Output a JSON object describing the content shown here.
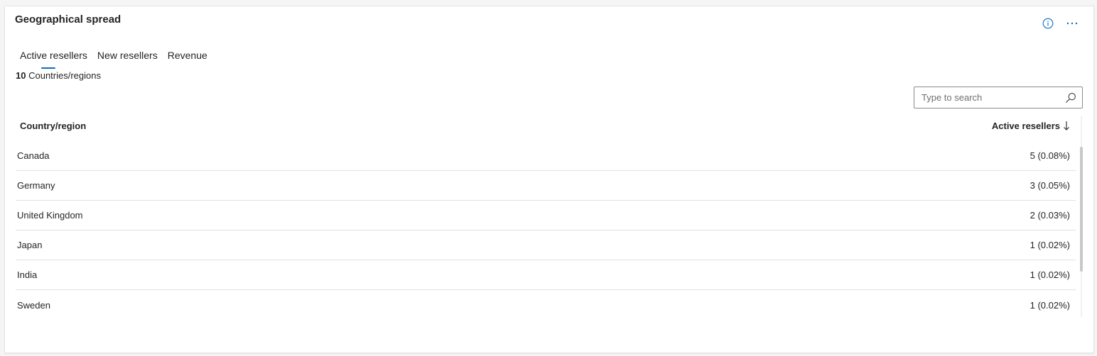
{
  "widget": {
    "title": "Geographical spread",
    "info_icon": "info-icon",
    "more_icon": "more-horizontal-icon"
  },
  "tabs": [
    {
      "label": "Active resellers",
      "active": true
    },
    {
      "label": "New resellers",
      "active": false
    },
    {
      "label": "Revenue",
      "active": false
    }
  ],
  "summary": {
    "count": "10",
    "label": "Countries/regions"
  },
  "search": {
    "placeholder": "Type to search",
    "value": "",
    "icon": "search-icon"
  },
  "table": {
    "headers": {
      "country": "Country/region",
      "value": "Active resellers",
      "sort_icon": "arrow-down-icon"
    },
    "rows": [
      {
        "country": "Canada",
        "value": "5 (0.08%)"
      },
      {
        "country": "Germany",
        "value": "3 (0.05%)"
      },
      {
        "country": "United Kingdom",
        "value": "2 (0.03%)"
      },
      {
        "country": "Japan",
        "value": "1 (0.02%)"
      },
      {
        "country": "India",
        "value": "1 (0.02%)"
      },
      {
        "country": "Sweden",
        "value": "1 (0.02%)"
      }
    ]
  },
  "colors": {
    "accent": "#0f6cbd",
    "text": "#242424",
    "divider": "#e0e0e0"
  }
}
